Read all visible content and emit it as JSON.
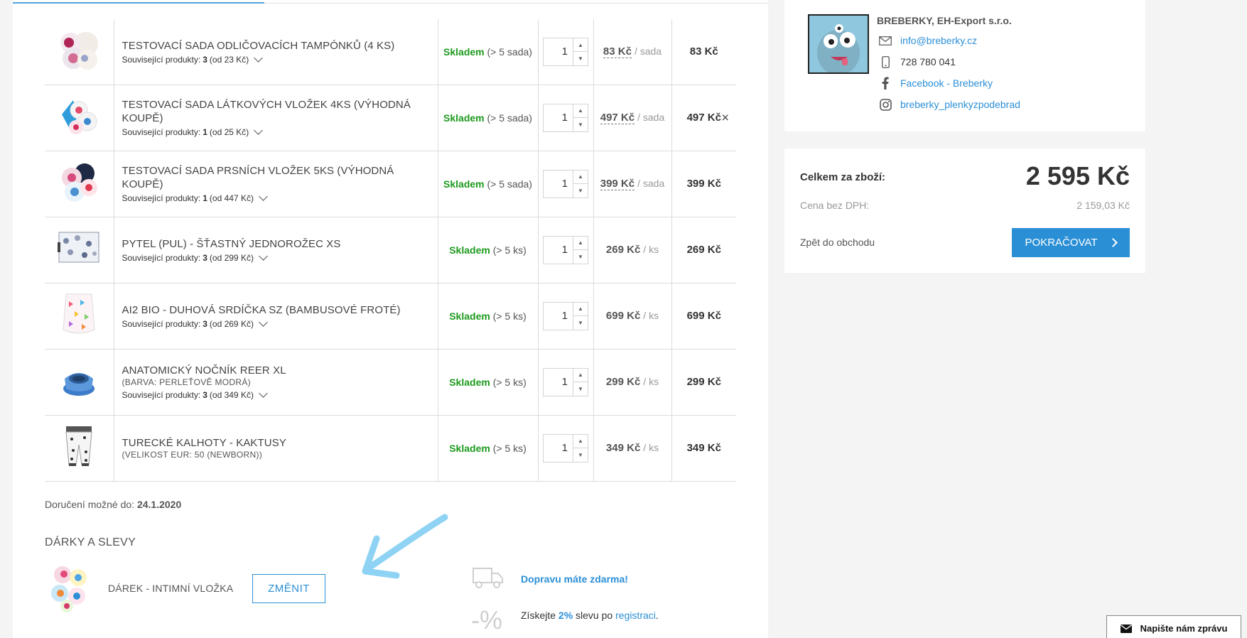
{
  "cart": {
    "items": [
      {
        "name": "TESTOVACÍ SADA ODLIČOVACÍCH TAMPÓNKŮ (4 KS)",
        "variant": "",
        "related_label": "Související produkty:",
        "related_count": "3",
        "related_from": "(od 23 Kč)",
        "stock": "Skladem",
        "stock_detail": "(> 5 sada)",
        "qty": "1",
        "unit_price": "83 Kč",
        "unit": "/ sada",
        "total": "83 Kč",
        "dashed": true,
        "thumb": "pads"
      },
      {
        "name": "TESTOVACÍ SADA LÁTKOVÝCH VLOŽEK 4KS (VÝHODNÁ KOUPĚ)",
        "variant": "",
        "related_label": "Související produkty:",
        "related_count": "1",
        "related_from": "(od 25 Kč)",
        "stock": "Skladem",
        "stock_detail": "(> 5 sada)",
        "qty": "1",
        "unit_price": "497 Kč",
        "unit": "/ sada",
        "total": "497 Kč",
        "dashed": true,
        "thumb": "liners",
        "remove": "×"
      },
      {
        "name": "TESTOVACÍ SADA PRSNÍCH VLOŽEK 5KS (VÝHODNÁ KOUPĚ)",
        "variant": "",
        "related_label": "Související produkty:",
        "related_count": "1",
        "related_from": "(od 447 Kč)",
        "stock": "Skladem",
        "stock_detail": "(> 5 sada)",
        "qty": "1",
        "unit_price": "399 Kč",
        "unit": "/ sada",
        "total": "399 Kč",
        "dashed": true,
        "thumb": "breastpads"
      },
      {
        "name": "PYTEL (PUL) - ŠŤASTNÝ JEDNOROŽEC XS",
        "variant": "",
        "related_label": "Související produkty:",
        "related_count": "3",
        "related_from": "(od 299 Kč)",
        "stock": "Skladem",
        "stock_detail": "(> 5 ks)",
        "qty": "1",
        "unit_price": "269 Kč",
        "unit": "/ ks",
        "total": "269 Kč",
        "dashed": false,
        "thumb": "bag"
      },
      {
        "name": "AI2 BIO - DUHOVÁ SRDÍČKA SZ (BAMBUSOVÉ FROTÉ)",
        "variant": "",
        "related_label": "Související produkty:",
        "related_count": "3",
        "related_from": "(od 269 Kč)",
        "stock": "Skladem",
        "stock_detail": "(> 5 ks)",
        "qty": "1",
        "unit_price": "699 Kč",
        "unit": "/ ks",
        "total": "699 Kč",
        "dashed": false,
        "thumb": "diaper"
      },
      {
        "name": "ANATOMICKÝ NOČNÍK REER XL",
        "variant": "(BARVA: PERLEŤOVĚ MODRÁ)",
        "related_label": "Související produkty:",
        "related_count": "3",
        "related_from": "(od 349 Kč)",
        "stock": "Skladem",
        "stock_detail": "(> 5 ks)",
        "qty": "1",
        "unit_price": "299 Kč",
        "unit": "/ ks",
        "total": "299 Kč",
        "dashed": false,
        "thumb": "potty"
      },
      {
        "name": "TURECKÉ KALHOTY - KAKTUSY",
        "variant": "(VELIKOST EUR: 50 (NEWBORN))",
        "related_label": "",
        "related_count": "",
        "related_from": "",
        "stock": "Skladem",
        "stock_detail": "(> 5 ks)",
        "qty": "1",
        "unit_price": "349 Kč",
        "unit": "/ ks",
        "total": "349 Kč",
        "dashed": false,
        "thumb": "pants"
      }
    ]
  },
  "delivery": {
    "label": "Doručení možné do:",
    "date": "24.1.2020"
  },
  "gifts": {
    "title": "DÁRKY A SLEVY",
    "gift_name": "DÁREK - INTIMNÍ VLOŽKA",
    "change_button": "ZMĚNIT",
    "free_shipping": "Dopravu máte zdarma!",
    "discount_prefix": "Získejte",
    "discount_value": "2%",
    "discount_mid": "slevu po",
    "discount_link": "registraci",
    "discount_suffix": ".",
    "pct_icon": "-%"
  },
  "contact": {
    "company": "BREBERKY, EH-Export s.r.o.",
    "email": "info@breberky.cz",
    "phone": "728 780 041",
    "facebook": "Facebook - Breberky",
    "instagram": "breberky_plenkyzpodebrad"
  },
  "summary": {
    "total_label": "Celkem za zboží:",
    "total": "2 595 Kč",
    "ex_vat_label": "Cena bez DPH:",
    "ex_vat": "2 159,03 Kč",
    "back": "Zpět do obchodu",
    "continue": "POKRAČOVAT"
  },
  "chat": {
    "label": "Napište nám zprávu"
  },
  "colors": {
    "accent": "#2b8fd6",
    "instock": "#1d9a1d",
    "arrow": "#8fd3f4"
  }
}
